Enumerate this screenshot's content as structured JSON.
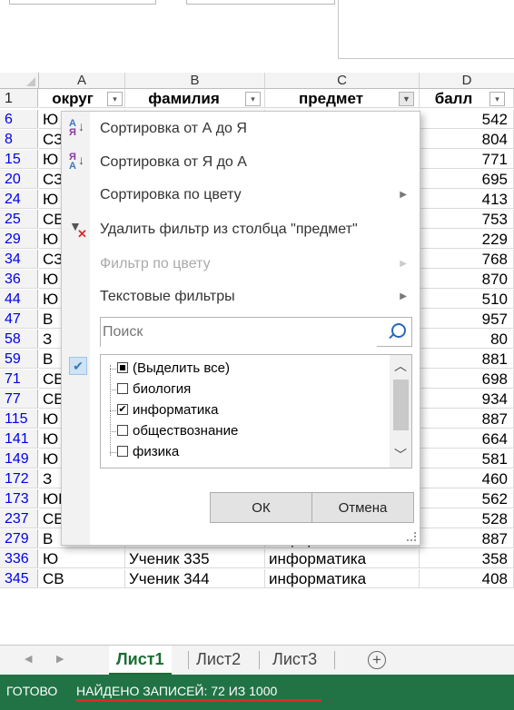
{
  "columns": [
    "A",
    "B",
    "C",
    "D"
  ],
  "header_row": {
    "num": "1",
    "cells": [
      "округ",
      "фамилия",
      "предмет",
      "балл"
    ]
  },
  "rows": [
    {
      "num": "6",
      "a": "Ю",
      "b": "",
      "c": "",
      "d": "542"
    },
    {
      "num": "8",
      "a": "СЗ",
      "b": "",
      "c": "",
      "d": "804"
    },
    {
      "num": "15",
      "a": "Ю",
      "b": "",
      "c": "",
      "d": "771"
    },
    {
      "num": "20",
      "a": "СЗ",
      "b": "",
      "c": "",
      "d": "695"
    },
    {
      "num": "24",
      "a": "Ю",
      "b": "",
      "c": "",
      "d": "413"
    },
    {
      "num": "25",
      "a": "СВ",
      "b": "",
      "c": "",
      "d": "753"
    },
    {
      "num": "29",
      "a": "Ю",
      "b": "",
      "c": "",
      "d": "229"
    },
    {
      "num": "34",
      "a": "СЗ",
      "b": "",
      "c": "",
      "d": "768"
    },
    {
      "num": "36",
      "a": "Ю",
      "b": "",
      "c": "",
      "d": "870"
    },
    {
      "num": "44",
      "a": "Ю",
      "b": "",
      "c": "",
      "d": "510"
    },
    {
      "num": "47",
      "a": "В",
      "b": "",
      "c": "",
      "d": "957"
    },
    {
      "num": "58",
      "a": "З",
      "b": "",
      "c": "",
      "d": "80"
    },
    {
      "num": "59",
      "a": "В",
      "b": "",
      "c": "",
      "d": "881"
    },
    {
      "num": "71",
      "a": "СВ",
      "b": "",
      "c": "",
      "d": "698"
    },
    {
      "num": "77",
      "a": "СВ",
      "b": "",
      "c": "",
      "d": "934"
    },
    {
      "num": "115",
      "a": "Ю",
      "b": "",
      "c": "",
      "d": "887"
    },
    {
      "num": "141",
      "a": "Ю",
      "b": "",
      "c": "",
      "d": "664"
    },
    {
      "num": "149",
      "a": "Ю",
      "b": "",
      "c": "",
      "d": "581"
    },
    {
      "num": "172",
      "a": "З",
      "b": "",
      "c": "",
      "d": "460"
    },
    {
      "num": "173",
      "a": "ЮВ",
      "b": "Ученик 172",
      "c": "информатика",
      "d": "562"
    },
    {
      "num": "237",
      "a": "СВ",
      "b": "Ученик 236",
      "c": "информатика",
      "d": "528"
    },
    {
      "num": "279",
      "a": "В",
      "b": "Ученик 278",
      "c": "информатика",
      "d": "887"
    },
    {
      "num": "336",
      "a": "Ю",
      "b": "Ученик 335",
      "c": "информатика",
      "d": "358"
    },
    {
      "num": "345",
      "a": "СВ",
      "b": "Ученик 344",
      "c": "информатика",
      "d": "408"
    }
  ],
  "filter_menu": {
    "sort_az": "Сортировка от А до Я",
    "sort_za": "Сортировка от Я до А",
    "sort_color": "Сортировка по цвету",
    "clear_filter": "Удалить фильтр из столбца \"предмет\"",
    "filter_color": "Фильтр по цвету",
    "text_filters": "Текстовые фильтры",
    "search_placeholder": "Поиск",
    "items": [
      {
        "label": "(Выделить все)",
        "state": "partial"
      },
      {
        "label": "биология",
        "state": "unchecked"
      },
      {
        "label": "информатика",
        "state": "checked"
      },
      {
        "label": "обществознание",
        "state": "unchecked"
      },
      {
        "label": "физика",
        "state": "unchecked"
      }
    ],
    "ok": "ОК",
    "cancel": "Отмена"
  },
  "sheets": {
    "tabs": [
      "Лист1",
      "Лист2",
      "Лист3"
    ],
    "active": "Лист1"
  },
  "status": {
    "ready": "ГОТОВО",
    "found": "НАЙДЕНО ЗАПИСЕЙ: 72 ИЗ 1000"
  },
  "colors": {
    "status_bar": "#217346",
    "active_tab": "#1b6e35",
    "row_number": "#0000ee",
    "underline": "#e5242b"
  }
}
